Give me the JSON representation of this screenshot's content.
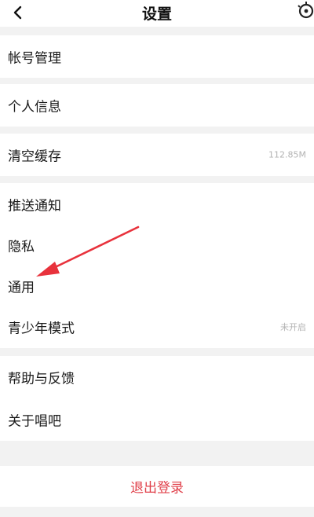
{
  "header": {
    "title": "设置",
    "back_icon": "chevron-left-icon",
    "right_icon": "settings-icon"
  },
  "groups": [
    {
      "items": [
        {
          "label": "帐号管理"
        },
        {
          "label": "个人信息"
        }
      ]
    },
    {
      "items": [
        {
          "label": "清空缓存",
          "value": "112.85M"
        }
      ]
    },
    {
      "items": [
        {
          "label": "推送通知"
        },
        {
          "label": "隐私"
        },
        {
          "label": "通用"
        },
        {
          "label": "青少年模式",
          "value": "未开启"
        }
      ]
    },
    {
      "items": [
        {
          "label": "帮助与反馈"
        },
        {
          "label": "关于唱吧"
        }
      ]
    }
  ],
  "logout": {
    "label": "退出登录"
  },
  "colors": {
    "background": "#f2f2f2",
    "logout_text": "#e0404a",
    "annotation_arrow": "#e8323c",
    "secondary_text": "#b3b3b3"
  }
}
